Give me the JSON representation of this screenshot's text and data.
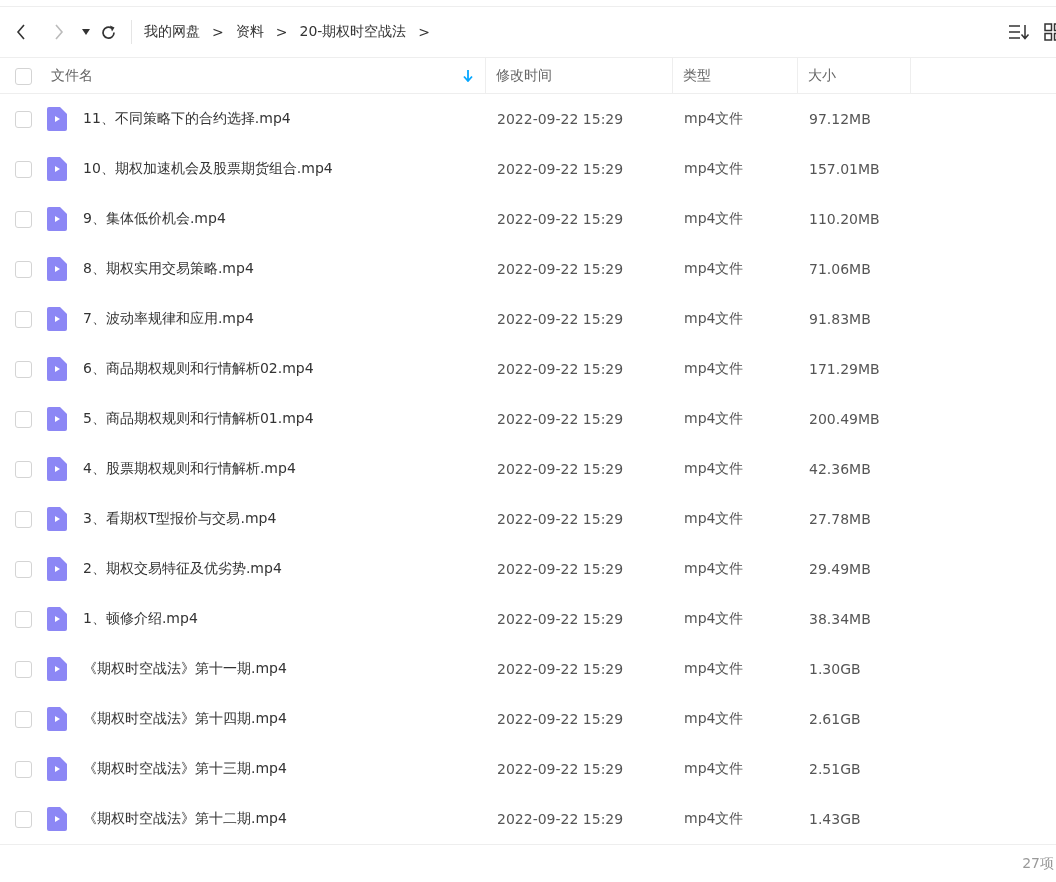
{
  "toolbar": {
    "breadcrumbs": [
      {
        "label": "我的网盘",
        "separator": ">"
      },
      {
        "label": "资料",
        "separator": ">"
      },
      {
        "label": "20-期权时空战法",
        "separator": ">"
      }
    ]
  },
  "table": {
    "all_checked": false,
    "columns": [
      {
        "label": "文件名",
        "sorted": true
      },
      {
        "label": "修改时间",
        "sorted": false
      },
      {
        "label": "类型",
        "sorted": false
      },
      {
        "label": "大小",
        "sorted": false
      }
    ],
    "rows": [
      {
        "checked": false,
        "name": "11、不同策略下的合约选择.mp4",
        "modified": "2022-09-22 15:29",
        "type": "mp4文件",
        "size": "97.12MB"
      },
      {
        "checked": false,
        "name": "10、期权加速机会及股票期货组合.mp4",
        "modified": "2022-09-22 15:29",
        "type": "mp4文件",
        "size": "157.01MB"
      },
      {
        "checked": false,
        "name": "9、集体低价机会.mp4",
        "modified": "2022-09-22 15:29",
        "type": "mp4文件",
        "size": "110.20MB"
      },
      {
        "checked": false,
        "name": "8、期权实用交易策略.mp4",
        "modified": "2022-09-22 15:29",
        "type": "mp4文件",
        "size": "71.06MB"
      },
      {
        "checked": false,
        "name": "7、波动率规律和应用.mp4",
        "modified": "2022-09-22 15:29",
        "type": "mp4文件",
        "size": "91.83MB"
      },
      {
        "checked": false,
        "name": "6、商品期权规则和行情解析02.mp4",
        "modified": "2022-09-22 15:29",
        "type": "mp4文件",
        "size": "171.29MB"
      },
      {
        "checked": false,
        "name": "5、商品期权规则和行情解析01.mp4",
        "modified": "2022-09-22 15:29",
        "type": "mp4文件",
        "size": "200.49MB"
      },
      {
        "checked": false,
        "name": "4、股票期权规则和行情解析.mp4",
        "modified": "2022-09-22 15:29",
        "type": "mp4文件",
        "size": "42.36MB"
      },
      {
        "checked": false,
        "name": "3、看期权T型报价与交易.mp4",
        "modified": "2022-09-22 15:29",
        "type": "mp4文件",
        "size": "27.78MB"
      },
      {
        "checked": false,
        "name": "2、期权交易特征及优劣势.mp4",
        "modified": "2022-09-22 15:29",
        "type": "mp4文件",
        "size": "29.49MB"
      },
      {
        "checked": false,
        "name": "1、顿修介绍.mp4",
        "modified": "2022-09-22 15:29",
        "type": "mp4文件",
        "size": "38.34MB"
      },
      {
        "checked": false,
        "name": "《期权时空战法》第十一期.mp4",
        "modified": "2022-09-22 15:29",
        "type": "mp4文件",
        "size": "1.30GB"
      },
      {
        "checked": false,
        "name": "《期权时空战法》第十四期.mp4",
        "modified": "2022-09-22 15:29",
        "type": "mp4文件",
        "size": "2.61GB"
      },
      {
        "checked": false,
        "name": "《期权时空战法》第十三期.mp4",
        "modified": "2022-09-22 15:29",
        "type": "mp4文件",
        "size": "2.51GB"
      },
      {
        "checked": false,
        "name": "《期权时空战法》第十二期.mp4",
        "modified": "2022-09-22 15:29",
        "type": "mp4文件",
        "size": "1.43GB"
      }
    ]
  },
  "status_bar": {
    "item_count": "27项"
  }
}
